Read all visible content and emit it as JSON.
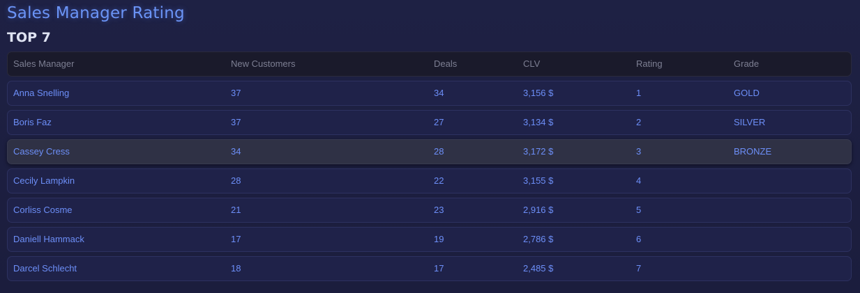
{
  "header": {
    "title": "Sales Manager Rating",
    "subtitle": "TOP 7"
  },
  "table": {
    "columns": [
      "Sales Manager",
      "New Customers",
      "Deals",
      "CLV",
      "Rating",
      "Grade"
    ],
    "rows": [
      {
        "manager": "Anna Snelling",
        "new_customers": "37",
        "deals": "34",
        "clv": "3,156 $",
        "rating": "1",
        "grade": "GOLD"
      },
      {
        "manager": "Boris Faz",
        "new_customers": "37",
        "deals": "27",
        "clv": "3,134 $",
        "rating": "2",
        "grade": "SILVER"
      },
      {
        "manager": "Cassey Cress",
        "new_customers": "34",
        "deals": "28",
        "clv": "3,172 $",
        "rating": "3",
        "grade": "BRONZE",
        "hovered": true
      },
      {
        "manager": "Cecily Lampkin",
        "new_customers": "28",
        "deals": "22",
        "clv": "3,155 $",
        "rating": "4",
        "grade": ""
      },
      {
        "manager": "Corliss Cosme",
        "new_customers": "21",
        "deals": "23",
        "clv": "2,916 $",
        "rating": "5",
        "grade": ""
      },
      {
        "manager": "Daniell Hammack",
        "new_customers": "17",
        "deals": "19",
        "clv": "2,786 $",
        "rating": "6",
        "grade": ""
      },
      {
        "manager": "Darcel Schlecht",
        "new_customers": "18",
        "deals": "17",
        "clv": "2,485 $",
        "rating": "7",
        "grade": ""
      }
    ]
  },
  "colors": {
    "background": "#1e2144",
    "title": "#6b94f6",
    "row_text": "#6d8ff8",
    "header_text": "#7d7f93",
    "highlight_row": "#2f3145"
  }
}
